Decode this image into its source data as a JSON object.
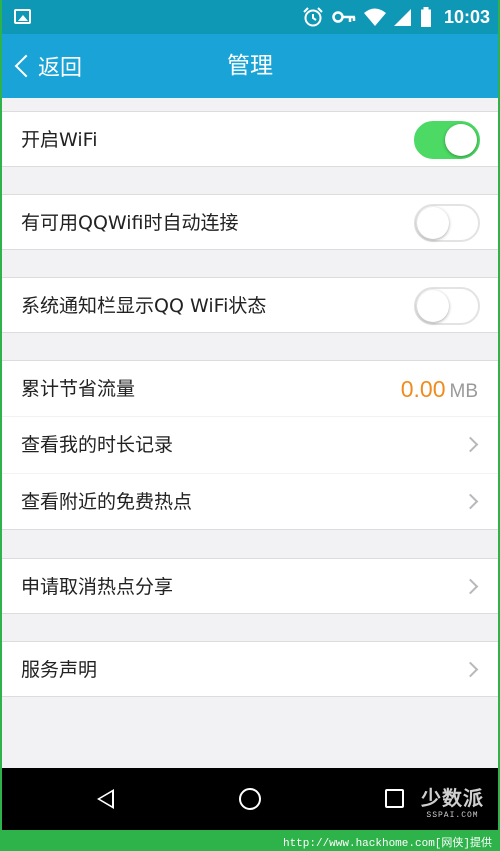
{
  "status_bar": {
    "time": "10:03",
    "icons": [
      "image-icon",
      "alarm-icon",
      "key-icon",
      "wifi-icon",
      "signal-icon",
      "battery-icon"
    ]
  },
  "nav": {
    "back_label": "返回",
    "title": "管理"
  },
  "settings": {
    "wifi": {
      "label": "开启WiFi",
      "on": true
    },
    "auto_connect": {
      "label": "有可用QQWifi时自动连接",
      "on": false
    },
    "notify_status": {
      "label": "系统通知栏显示QQ WiFi状态",
      "on": false
    },
    "saved_traffic": {
      "label": "累计节省流量",
      "value": "0.00",
      "unit": "MB"
    },
    "duration_log": {
      "label": "查看我的时长记录"
    },
    "nearby_hotspots": {
      "label": "查看附近的免费热点"
    },
    "cancel_share": {
      "label": "申请取消热点分享"
    },
    "service_terms": {
      "label": "服务声明"
    }
  },
  "watermark": {
    "main": "少数派",
    "sub": "SSPAI.COM"
  },
  "footer": {
    "text": "http://www.hackhome.com[网侠]提供"
  },
  "colors": {
    "status_bar": "#0f97b6",
    "nav_bar": "#1aa3d6",
    "toggle_on": "#4cd964",
    "value_accent": "#f08c1e",
    "frame": "#2eb24a"
  }
}
